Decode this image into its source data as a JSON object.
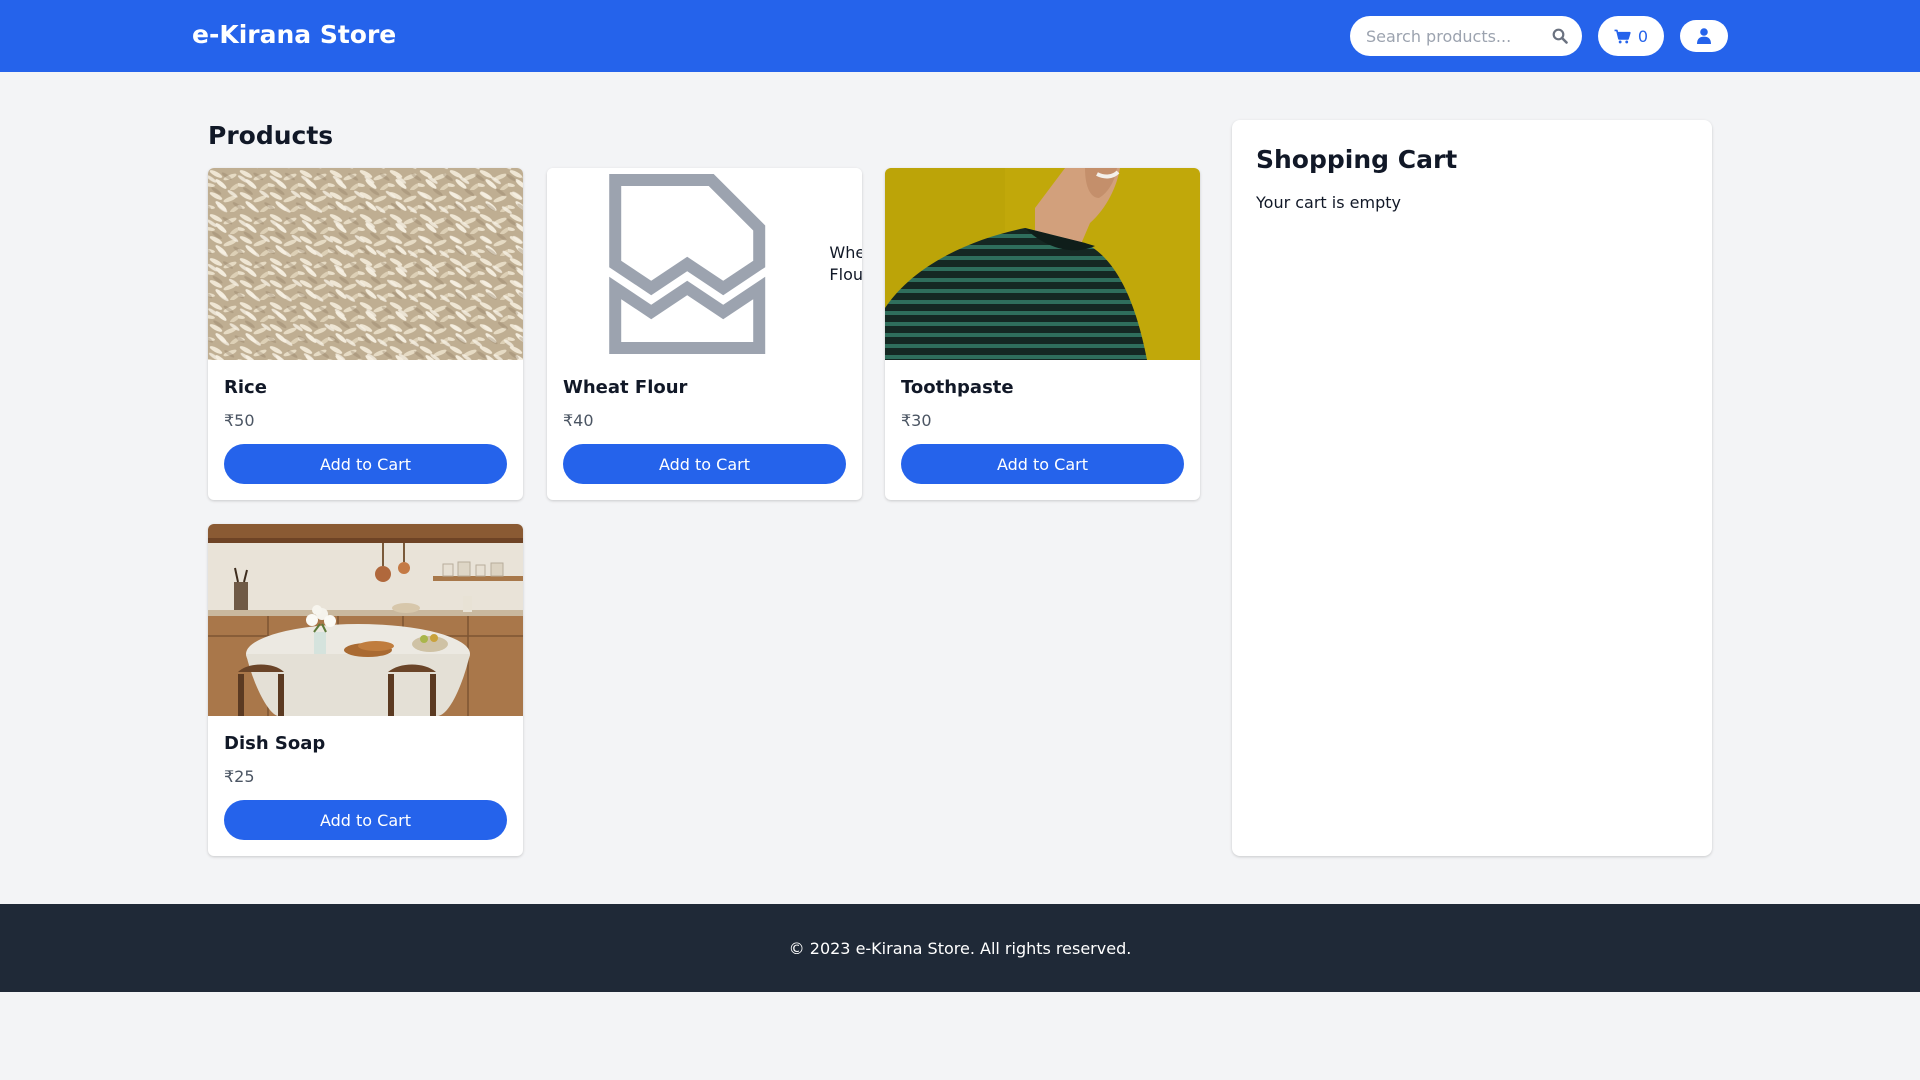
{
  "header": {
    "brand": "e-Kirana Store",
    "search_placeholder": "Search products...",
    "search_icon": "search-icon",
    "cart_icon": "shopping-cart-icon",
    "cart_count": "0",
    "user_icon": "user-icon",
    "background_color": "#2563eb"
  },
  "products": {
    "title": "Products",
    "add_label": "Add to Cart",
    "items": [
      {
        "name": "Rice",
        "price": "₹50",
        "image_alt": "Rice",
        "image_loaded": true
      },
      {
        "name": "Wheat Flour",
        "price": "₹40",
        "image_alt": "Wheat Flour",
        "image_loaded": false
      },
      {
        "name": "Toothpaste",
        "price": "₹30",
        "image_alt": "Toothpaste",
        "image_loaded": true
      },
      {
        "name": "Dish Soap",
        "price": "₹25",
        "image_alt": "Dish Soap",
        "image_loaded": true
      }
    ]
  },
  "cart": {
    "title": "Shopping Cart",
    "empty_message": "Your cart is empty"
  },
  "footer": {
    "text": "© 2023 e-Kirana Store. All rights reserved.",
    "background_color": "#1f2937"
  },
  "colors": {
    "accent": "#2563eb",
    "page_background": "#f3f4f6"
  }
}
